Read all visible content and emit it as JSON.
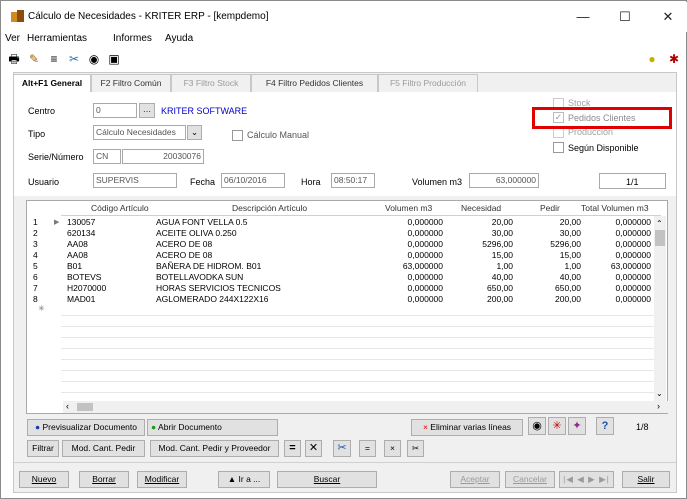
{
  "window": {
    "title": "Cálculo de Necesidades - KRITER ERP - [kempdemo]",
    "minimize": "—",
    "maximize": "☐",
    "close": "✕"
  },
  "menu": [
    "Ver",
    "Herramientas",
    "Informes",
    "Ayuda"
  ],
  "tabs": [
    "Alt+F1 General",
    "F2 Filtro Común",
    "F3 Filtro Stock",
    "F4 Filtro Pedidos Clientes",
    "F5 Filtro Producción"
  ],
  "form": {
    "centro_label": "Centro",
    "centro_value": "0",
    "centro_name": "KRITER SOFTWARE",
    "tipo_label": "Tipo",
    "tipo_value": "Cálculo Necesidades",
    "calc_manual": "Cálculo Manual",
    "serie_label": "Serie/Número",
    "serie_value": "CN",
    "numero_value": "20030076",
    "usuario_label": "Usuario",
    "usuario_value": "SUPERVIS",
    "fecha_label": "Fecha",
    "fecha_value": "06/10/2016",
    "hora_label": "Hora",
    "hora_value": "08:50:17",
    "volumen_label": "Volumen m3",
    "volumen_value": "63,000000",
    "pager": "1/1"
  },
  "options": {
    "stock": "Stock",
    "pedidos": "Pedidos Clientes",
    "produccion": "Producción",
    "segun": "Según Disponible"
  },
  "grid": {
    "headers": [
      "Código Artículo",
      "Descripción Artículo",
      "Volumen m3",
      "Necesidad",
      "Pedir",
      "Total Volumen m3"
    ],
    "rows": [
      [
        "1",
        "130057",
        "AGUA FONT VELLA 0.5",
        "0,000000",
        "20,00",
        "20,00",
        "0,000000"
      ],
      [
        "2",
        "620134",
        "ACEITE OLIVA 0.250",
        "0,000000",
        "30,00",
        "30,00",
        "0,000000"
      ],
      [
        "3",
        "AA08",
        "ACERO DE 08",
        "0,000000",
        "5296,00",
        "5296,00",
        "0,000000"
      ],
      [
        "4",
        "AA08",
        "ACERO DE 08",
        "0,000000",
        "15,00",
        "15,00",
        "0,000000"
      ],
      [
        "5",
        "B01",
        "BAÑERA DE HIDROM. B01",
        "63,000000",
        "1,00",
        "1,00",
        "63,000000"
      ],
      [
        "6",
        "BOTEVS",
        "BOTELLAVODKA SUN",
        "0,000000",
        "40,00",
        "40,00",
        "0,000000"
      ],
      [
        "7",
        "H2070000",
        "HORAS SERVICIOS TECNICOS",
        "0,000000",
        "650,00",
        "650,00",
        "0,000000"
      ],
      [
        "8",
        "MAD01",
        "AGLOMERADO 244X122X16",
        "0,000000",
        "200,00",
        "200,00",
        "0,000000"
      ]
    ],
    "new_row_marker": "✳"
  },
  "actions": {
    "previsualizar": "Previsualizar Documento",
    "abrir": "Abrir Documento",
    "eliminar": "Eliminar varias líneas",
    "page": "1/8",
    "filtrar": "Filtrar",
    "mod_cant": "Mod. Cant. Pedir",
    "mod_cant_prov": "Mod. Cant. Pedir y Proveedor",
    "sym_eq": "=",
    "sym_x": "✕",
    "sym_scissors": "✂",
    "sym_eq2": "=",
    "sym_x2": "×",
    "sym_scissors2": "✂"
  },
  "bottom": {
    "nuevo": "Nuevo",
    "borrar": "Borrar",
    "modificar": "Modificar",
    "ira": "▲ Ir a ...",
    "buscar": "Buscar",
    "aceptar": "Aceptar",
    "cancelar": "Cancelar",
    "salir": "Salir"
  },
  "colors": {
    "accent_blue": "#0000cc",
    "highlight_red": "#e00000"
  }
}
